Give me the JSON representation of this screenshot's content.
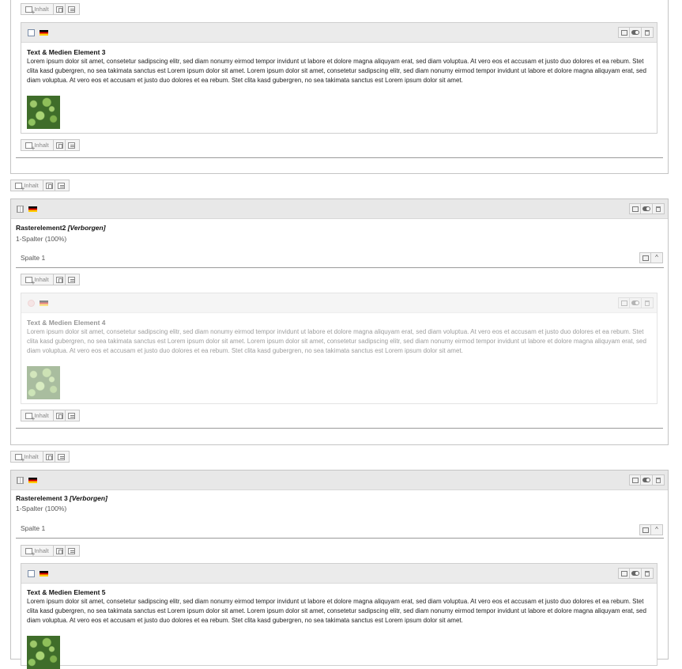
{
  "toolbar": {
    "content_label": "Inhalt"
  },
  "element3": {
    "title": "Text & Medien Element 3",
    "body": "Lorem ipsum dolor sit amet, consetetur sadipscing elitr, sed diam nonumy eirmod tempor invidunt ut labore et dolore magna aliquyam erat, sed diam voluptua. At vero eos et accusam et justo duo dolores et ea rebum. Stet clita kasd gubergren, no sea takimata sanctus est Lorem ipsum dolor sit amet. Lorem ipsum dolor sit amet, consetetur sadipscing elitr, sed diam nonumy eirmod tempor invidunt ut labore et dolore magna aliquyam erat, sed diam voluptua. At vero eos et accusam et justo duo dolores et ea rebum. Stet clita kasd gubergren, no sea takimata sanctus est Lorem ipsum dolor sit amet."
  },
  "grid2": {
    "title": "Rasterelement2",
    "hidden_label": "[Verborgen]",
    "subtitle": "1-Spalter (100%)",
    "column": "Spalte 1"
  },
  "element4": {
    "title": "Text & Medien Element 4",
    "body": "Lorem ipsum dolor sit amet, consetetur sadipscing elitr, sed diam nonumy eirmod tempor invidunt ut labore et dolore magna aliquyam erat, sed diam voluptua. At vero eos et accusam et justo duo dolores et ea rebum. Stet clita kasd gubergren, no sea takimata sanctus est Lorem ipsum dolor sit amet. Lorem ipsum dolor sit amet, consetetur sadipscing elitr, sed diam nonumy eirmod tempor invidunt ut labore et dolore magna aliquyam erat, sed diam voluptua. At vero eos et accusam et justo duo dolores et ea rebum. Stet clita kasd gubergren, no sea takimata sanctus est Lorem ipsum dolor sit amet."
  },
  "grid3": {
    "title": "Rasterelement 3",
    "hidden_label": "[Verborgen]",
    "subtitle": "1-Spalter (100%)",
    "column": "Spalte 1"
  },
  "element5": {
    "title": "Text & Medien Element 5",
    "body": "Lorem ipsum dolor sit amet, consetetur sadipscing elitr, sed diam nonumy eirmod tempor invidunt ut labore et dolore magna aliquyam erat, sed diam voluptua. At vero eos et accusam et justo duo dolores et ea rebum. Stet clita kasd gubergren, no sea takimata sanctus est Lorem ipsum dolor sit amet. Lorem ipsum dolor sit amet, consetetur sadipscing elitr, sed diam nonumy eirmod tempor invidunt ut labore et dolore magna aliquyam erat, sed diam voluptua. At vero eos et accusam et justo duo dolores et ea rebum. Stet clita kasd gubergren, no sea takimata sanctus est Lorem ipsum dolor sit amet."
  }
}
